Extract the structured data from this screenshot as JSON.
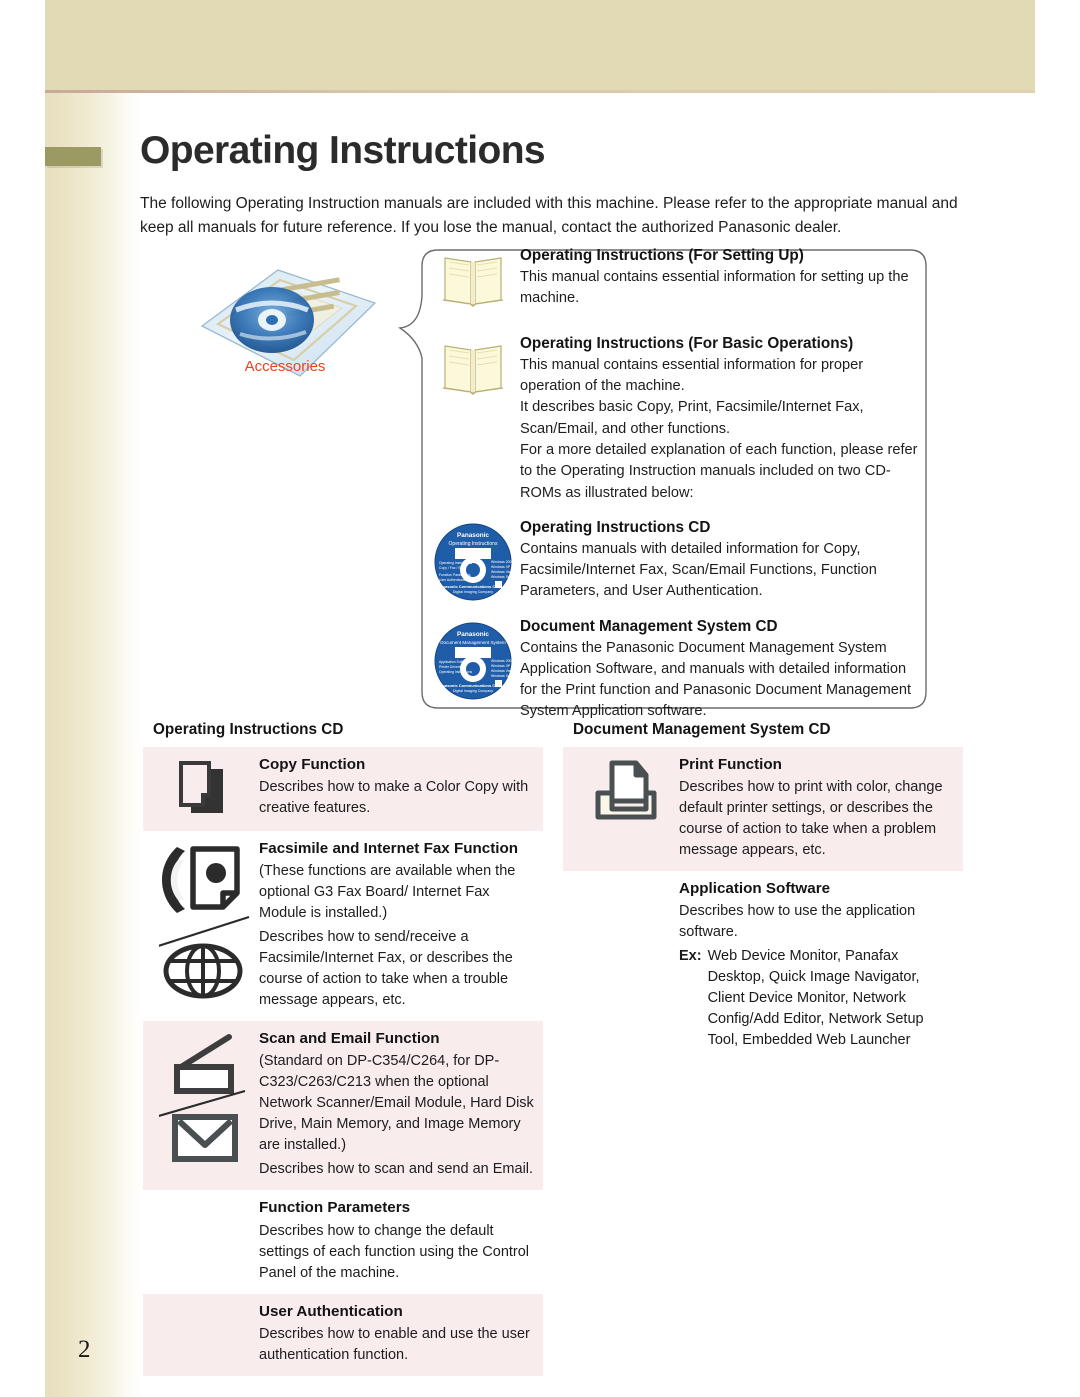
{
  "document": {
    "title": "Operating Instructions",
    "page_number": "2",
    "intro": "The following Operating Instruction manuals are included with this machine. Please refer to the appropriate manual and keep all manuals for future reference. If you lose the manual, contact the authorized Panasonic dealer."
  },
  "colors": {
    "header_band": "#e2dab4",
    "title_dash": "#9b9a63",
    "accessories_label": "#f0411b",
    "row_tint": "#f8ecec",
    "cd_blue": "#1f5da8"
  },
  "illustration": {
    "label": "Accessories",
    "icon": "accessories-package-icon"
  },
  "callout": {
    "items": [
      {
        "icon": "open-book-icon",
        "heading": "Operating Instructions (For Setting Up)",
        "paragraphs": [
          "This manual contains essential information for setting up the machine."
        ]
      },
      {
        "icon": "open-book-icon",
        "heading": "Operating Instructions (For Basic Operations)",
        "paragraphs": [
          "This manual contains essential information for proper operation of the machine.",
          "It describes basic Copy, Print, Facsimile/Internet Fax, Scan/Email, and other functions.",
          "For a more detailed explanation of each function, please refer to the Operating Instruction manuals included on two CD-ROMs as illustrated below:"
        ]
      },
      {
        "icon": "cd-disc-icon",
        "heading": "Operating Instructions CD",
        "paragraphs": [
          "Contains manuals with detailed information for Copy, Facsimile/Internet Fax, Scan/Email Functions, Function Parameters, and User Authentication."
        ]
      },
      {
        "icon": "cd-disc-icon",
        "heading": "Document Management System CD",
        "paragraphs": [
          "Contains the Panasonic Document Management System Application Software, and manuals with detailed information for the Print function and Panasonic Document Management System Application software."
        ]
      }
    ],
    "cd_labels": {
      "brand": "Panasonic",
      "disc1_subtitle": "Operating Instructions",
      "disc2_subtitle": "Document Management System"
    }
  },
  "left_column": {
    "heading": "Operating Instructions CD",
    "rows": [
      {
        "tint": true,
        "icon": "copy-pages-icon",
        "heading": "Copy Function",
        "paragraphs": [
          "Describes how to make a Color Copy with creative features."
        ]
      },
      {
        "tint": false,
        "icon": "fax-and-globe-icon",
        "heading": "Facsimile and Internet Fax Function",
        "paragraphs": [
          "(These functions are available when the optional G3 Fax Board/ Internet Fax Module is installed.)",
          "Describes how to send/receive a Facsimile/Internet Fax, or describes the course of action to take when a trouble message appears, etc."
        ]
      },
      {
        "tint": true,
        "icon": "scanner-and-envelope-icon",
        "heading": "Scan and Email Function",
        "paragraphs": [
          "(Standard on DP-C354/C264, for DP-C323/C263/C213 when the optional Network Scanner/Email Module, Hard Disk Drive, Main Memory, and Image Memory are installed.)",
          "Describes how to scan and send an Email."
        ]
      },
      {
        "tint": false,
        "icon": "none",
        "heading": "Function Parameters",
        "paragraphs": [
          "Describes how to change the default settings of each function using the Control Panel of the machine."
        ]
      },
      {
        "tint": true,
        "icon": "none",
        "heading": "User Authentication",
        "paragraphs": [
          "Describes how to enable and use the user authentication function."
        ]
      }
    ]
  },
  "right_column": {
    "heading": "Document Management System CD",
    "rows": [
      {
        "tint": true,
        "icon": "printer-icon",
        "heading": "Print Function",
        "paragraphs": [
          "Describes how to print with color, change default printer settings, or describes the course of action to take when a problem message appears, etc."
        ]
      },
      {
        "tint": false,
        "icon": "none",
        "heading": "Application Software",
        "paragraphs": [
          "Describes how to use the application software."
        ],
        "example_label": "Ex:",
        "example_text": "Web Device Monitor, Panafax Desktop, Quick Image Navigator, Client Device Monitor, Network Config/Add Editor, Network Setup Tool, Embedded Web Launcher"
      }
    ]
  }
}
